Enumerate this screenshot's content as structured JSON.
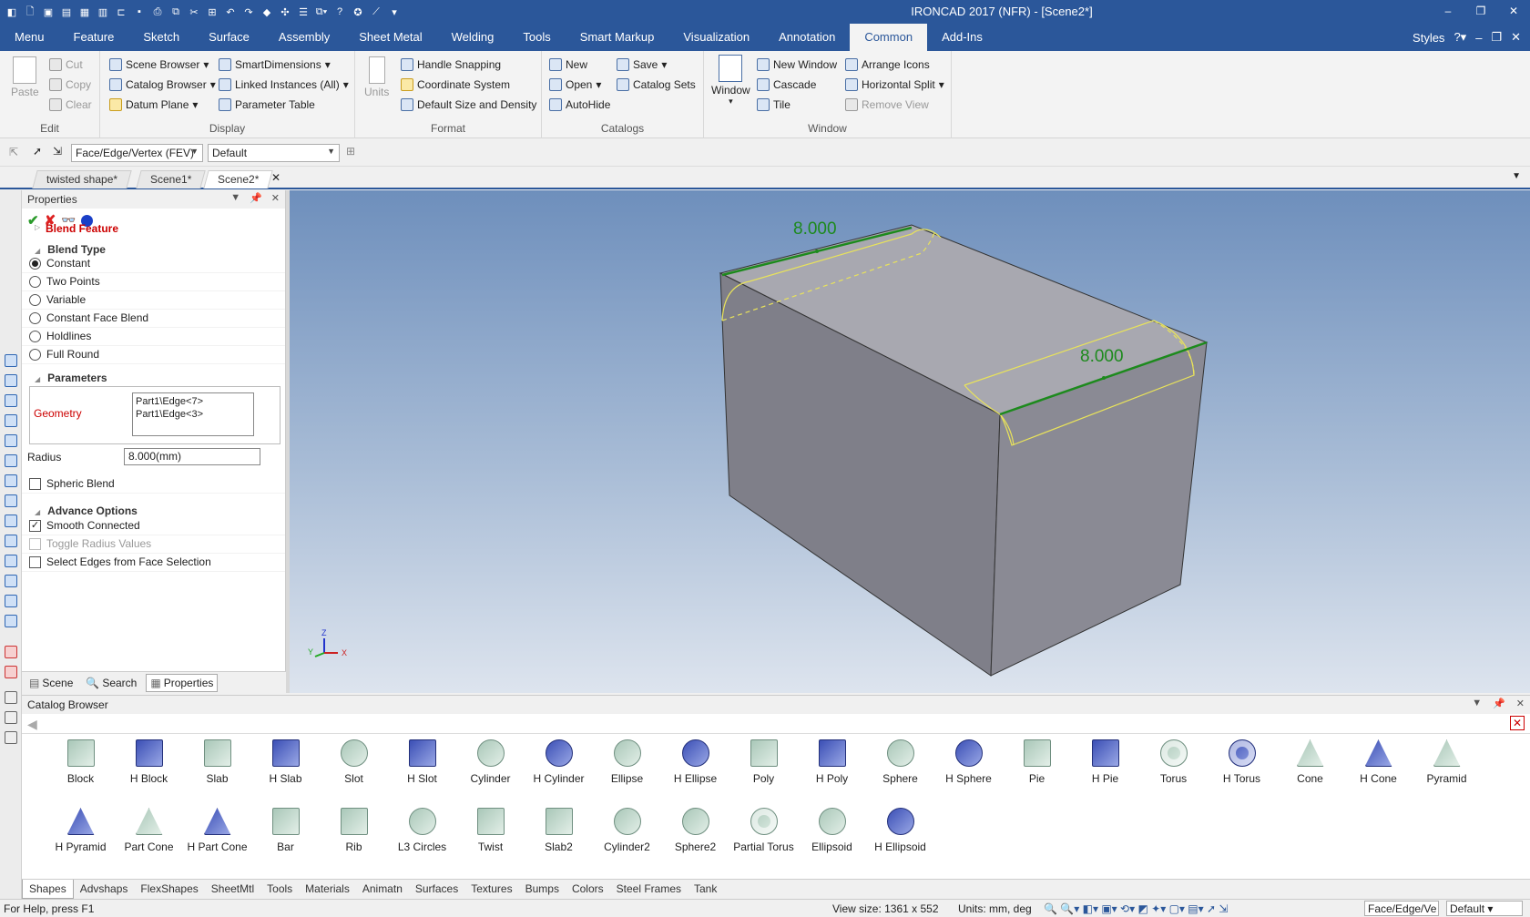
{
  "window": {
    "title": "IRONCAD 2017 (NFR) - [Scene2*]",
    "controls": [
      "–",
      "❐",
      "✕"
    ]
  },
  "ribbon_tabs": [
    "Menu",
    "Feature",
    "Sketch",
    "Surface",
    "Assembly",
    "Sheet Metal",
    "Welding",
    "Tools",
    "Smart Markup",
    "Visualization",
    "Annotation",
    "Common",
    "Add-Ins"
  ],
  "active_tab": "Common",
  "styles_label": "Styles",
  "ribbon": {
    "edit": {
      "label": "Edit",
      "paste": "Paste",
      "cut": "Cut",
      "copy": "Copy",
      "clear": "Clear"
    },
    "display": {
      "label": "Display",
      "scene_browser": "Scene Browser",
      "catalog_browser": "Catalog Browser",
      "datum_plane": "Datum Plane",
      "smart_dimensions": "SmartDimensions",
      "linked_instances": "Linked Instances (All)",
      "parameter_table": "Parameter Table"
    },
    "format": {
      "label": "Format",
      "units": "Units",
      "handle_snapping": "Handle Snapping",
      "coordinate_system": "Coordinate System",
      "default_size": "Default Size and Density"
    },
    "catalogs": {
      "label": "Catalogs",
      "new": "New",
      "open": "Open",
      "autohide": "AutoHide",
      "save": "Save",
      "catalog_sets": "Catalog Sets"
    },
    "window": {
      "label": "Window",
      "window": "Window",
      "new_window": "New Window",
      "cascade": "Cascade",
      "tile": "Tile",
      "arrange_icons": "Arrange Icons",
      "horizontal_split": "Horizontal Split",
      "remove_view": "Remove View"
    }
  },
  "selection_toolbar": {
    "filter": "Face/Edge/Vertex (FEV)",
    "style": "Default"
  },
  "doc_tabs": [
    "twisted shape*",
    "Scene1*",
    "Scene2*"
  ],
  "active_doc": "Scene2*",
  "properties": {
    "title": "Properties",
    "feature": "Blend Feature",
    "blend_type_heading": "Blend Type",
    "blend_types": [
      {
        "label": "Constant",
        "selected": true
      },
      {
        "label": "Two Points",
        "selected": false
      },
      {
        "label": "Variable",
        "selected": false
      },
      {
        "label": "Constant Face Blend",
        "selected": false
      },
      {
        "label": "Holdlines",
        "selected": false
      },
      {
        "label": "Full Round",
        "selected": false
      }
    ],
    "parameters_heading": "Parameters",
    "geometry_label": "Geometry",
    "geometry_items": [
      "Part1\\Edge<7>",
      "Part1\\Edge<3>"
    ],
    "radius_label": "Radius",
    "radius_value": "8.000(mm)",
    "spheric_blend": "Spheric Blend",
    "advance_heading": "Advance Options",
    "advance_options": [
      {
        "label": "Smooth Connected",
        "checked": true,
        "enabled": true
      },
      {
        "label": "Toggle Radius Values",
        "checked": false,
        "enabled": false
      },
      {
        "label": "Select Edges from Face Selection",
        "checked": false,
        "enabled": true
      }
    ],
    "bottom_tabs": [
      "Scene",
      "Search",
      "Properties"
    ]
  },
  "viewport": {
    "dimension_1": "8.000",
    "dimension_2": "8.000",
    "axis_z": "Z",
    "axis_x": "X",
    "axis_y": "Y"
  },
  "catalog": {
    "title": "Catalog Browser",
    "items": [
      "Block",
      "H Block",
      "Slab",
      "H Slab",
      "Slot",
      "H Slot",
      "Cylinder",
      "H Cylinder",
      "Ellipse",
      "H Ellipse",
      "Poly",
      "H Poly",
      "Sphere",
      "H Sphere",
      "Pie",
      "H Pie",
      "Torus",
      "H Torus",
      "Cone",
      "H Cone",
      "Pyramid",
      "H Pyramid",
      "Part Cone",
      "H Part Cone",
      "Bar",
      "Rib",
      "L3 Circles",
      "Twist",
      "Slab2",
      "Cylinder2",
      "Sphere2",
      "Partial Torus",
      "Ellipsoid",
      "H Ellipsoid"
    ],
    "tabs": [
      "Shapes",
      "Advshaps",
      "FlexShapes",
      "SheetMtl",
      "Tools",
      "Materials",
      "Animatn",
      "Surfaces",
      "Textures",
      "Bumps",
      "Colors",
      "Steel Frames",
      "Tank"
    ],
    "active_tab": "Shapes"
  },
  "status": {
    "help": "For Help, press F1",
    "view_size": "View size: 1361 x  552",
    "units": "Units: mm, deg",
    "filter": "Face/Edge/Ve",
    "style": "Default"
  }
}
